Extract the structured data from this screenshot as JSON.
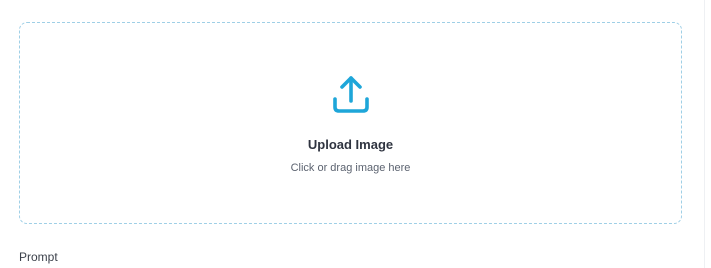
{
  "upload": {
    "icon": "upload-tray-icon",
    "title": "Upload Image",
    "subtitle": "Click or drag image here",
    "accent_color": "#1ea6d9",
    "border_color": "#9fcfe6"
  },
  "prompt": {
    "label": "Prompt"
  }
}
